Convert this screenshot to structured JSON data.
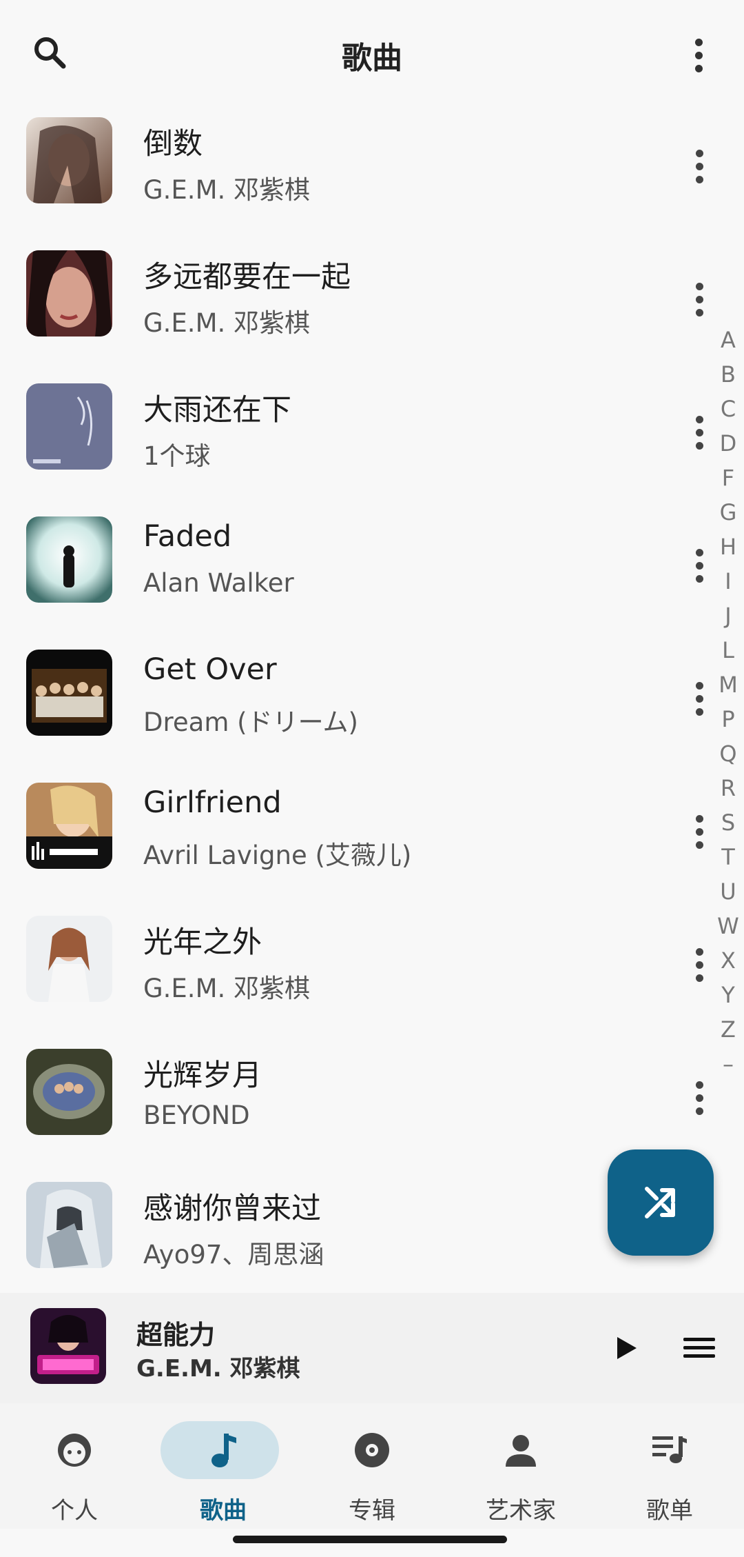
{
  "header": {
    "title": "歌曲"
  },
  "icons": {
    "search": "search-icon",
    "more": "more-vert-icon"
  },
  "songs": [
    {
      "title": "倒数",
      "artist": "G.E.M. 邓紫棋"
    },
    {
      "title": "多远都要在一起",
      "artist": "G.E.M. 邓紫棋"
    },
    {
      "title": "大雨还在下",
      "artist": "1个球"
    },
    {
      "title": "Faded",
      "artist": "Alan Walker"
    },
    {
      "title": "Get Over",
      "artist": "Dream (ドリーム)"
    },
    {
      "title": "Girlfriend",
      "artist": "Avril Lavigne (艾薇儿)"
    },
    {
      "title": "光年之外",
      "artist": "G.E.M. 邓紫棋"
    },
    {
      "title": "光辉岁月",
      "artist": "BEYOND"
    },
    {
      "title": "感谢你曾来过",
      "artist": "Ayo97、周思涵"
    }
  ],
  "alphabet": [
    "A",
    "B",
    "C",
    "D",
    "F",
    "G",
    "H",
    "I",
    "J",
    "L",
    "M",
    "P",
    "Q",
    "R",
    "S",
    "T",
    "U",
    "W",
    "X",
    "Y",
    "Z",
    "–"
  ],
  "now_playing": {
    "title": "超能力",
    "artist": "G.E.M. 邓紫棋"
  },
  "nav": [
    {
      "label": "个人"
    },
    {
      "label": "歌曲"
    },
    {
      "label": "专辑"
    },
    {
      "label": "艺术家"
    },
    {
      "label": "歌单"
    }
  ],
  "colors": {
    "accent": "#0f6289",
    "active_pill": "#cfe2ea",
    "background": "#f8f8f8"
  }
}
